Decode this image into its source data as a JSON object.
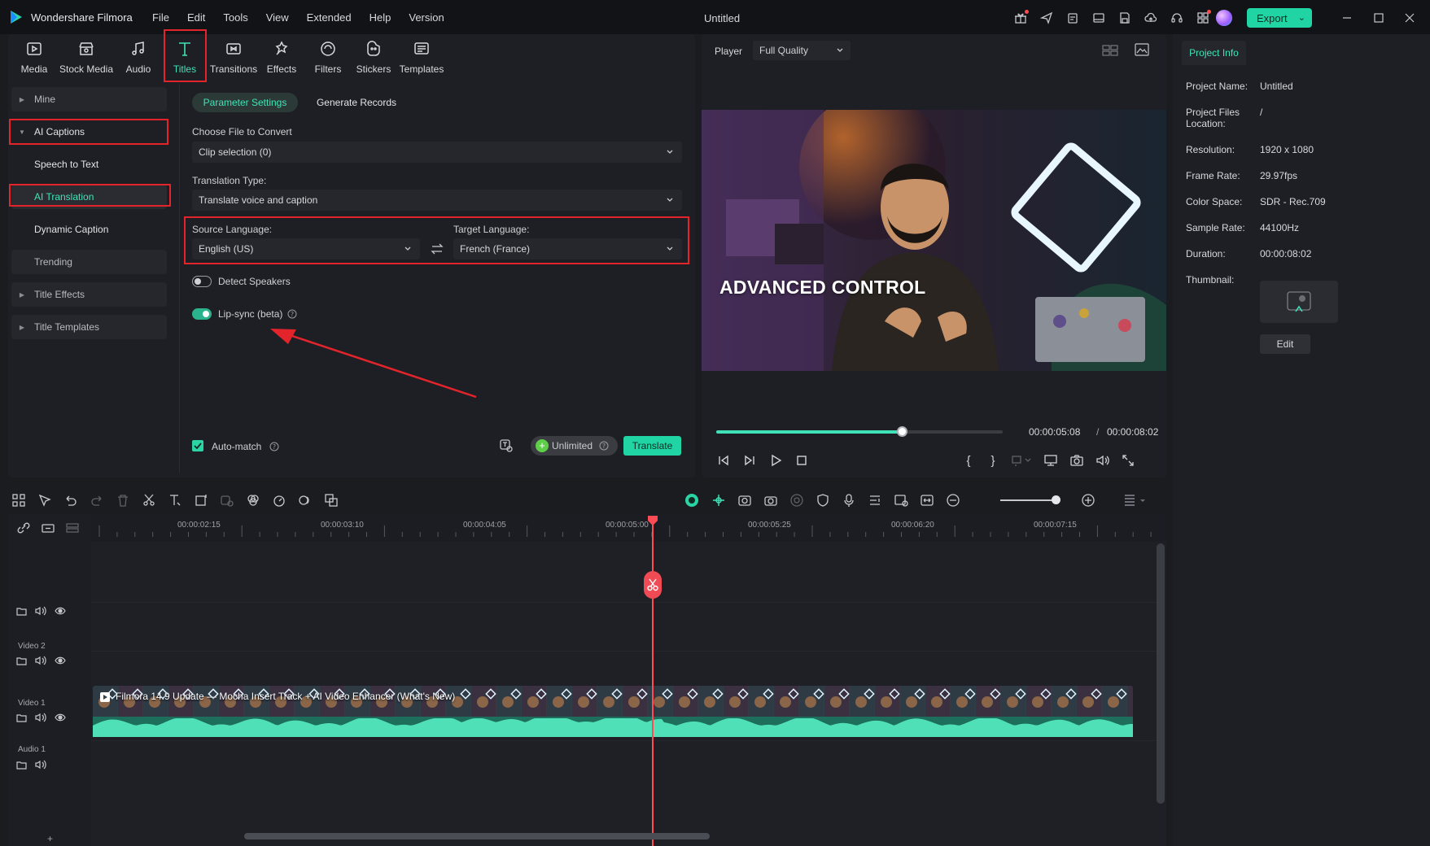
{
  "titlebar": {
    "app_name": "Wondershare Filmora",
    "menu": [
      "File",
      "Edit",
      "Tools",
      "View",
      "Extended",
      "Help",
      "Version"
    ],
    "window_title": "Untitled",
    "export_label": "Export"
  },
  "toolbar": {
    "items": [
      {
        "label": "Media",
        "icon": "media-icon"
      },
      {
        "label": "Stock Media",
        "icon": "stock-media-icon"
      },
      {
        "label": "Audio",
        "icon": "audio-icon"
      },
      {
        "label": "Titles",
        "icon": "titles-icon",
        "active": true
      },
      {
        "label": "Transitions",
        "icon": "transitions-icon"
      },
      {
        "label": "Effects",
        "icon": "effects-icon"
      },
      {
        "label": "Filters",
        "icon": "filters-icon"
      },
      {
        "label": "Stickers",
        "icon": "stickers-icon"
      },
      {
        "label": "Templates",
        "icon": "templates-icon"
      }
    ]
  },
  "sidebar": {
    "items": [
      {
        "label": "Mine"
      },
      {
        "label": "AI Captions"
      },
      {
        "label": "Speech to Text"
      },
      {
        "label": "AI Translation"
      },
      {
        "label": "Dynamic Caption"
      },
      {
        "label": "Trending"
      },
      {
        "label": "Title Effects"
      },
      {
        "label": "Title Templates"
      }
    ]
  },
  "settings": {
    "tab_parameter": "Parameter Settings",
    "tab_records": "Generate Records",
    "choose_file_label": "Choose File to Convert",
    "choose_file_value": "Clip selection (0)",
    "translation_type_label": "Translation Type:",
    "translation_type_value": "Translate voice and caption",
    "source_language_label": "Source Language:",
    "source_language_value": "English (US)",
    "target_language_label": "Target Language:",
    "target_language_value": "French (France)",
    "detect_speakers_label": "Detect Speakers",
    "detect_speakers_on": false,
    "lipsync_label": "Lip-sync (beta)",
    "lipsync_on": true,
    "automatch_label": "Auto-match",
    "automatch_checked": true,
    "unlimited_label": "Unlimited",
    "translate_label": "Translate"
  },
  "player": {
    "label": "Player",
    "quality": "Full Quality",
    "video_overlay_text": "ADVANCED CONTROL",
    "current_time": "00:00:05:08",
    "separator": "/",
    "total_time": "00:00:08:02",
    "progress": 0.65
  },
  "project_info": {
    "tab": "Project Info",
    "fields": [
      {
        "key": "Project Name:",
        "value": "Untitled"
      },
      {
        "key": "Project Files Location:",
        "value": "/"
      },
      {
        "key": "Resolution:",
        "value": "1920 x 1080"
      },
      {
        "key": "Frame Rate:",
        "value": "29.97fps"
      },
      {
        "key": "Color Space:",
        "value": "SDR - Rec.709"
      },
      {
        "key": "Sample Rate:",
        "value": "44100Hz"
      },
      {
        "key": "Duration:",
        "value": "00:00:08:02"
      },
      {
        "key": "Thumbnail:",
        "value": ""
      }
    ],
    "edit_label": "Edit"
  },
  "timeline": {
    "ticks": [
      "00:00:02:15",
      "00:00:03:10",
      "00:00:04:05",
      "00:00:05:00",
      "00:00:05:25",
      "00:00:06:20",
      "00:00:07:15"
    ],
    "tracks": {
      "video2": "Video 2",
      "video1": "Video 1",
      "audio1": "Audio 1"
    },
    "clip_title": "Filmora 14.9 Update — Mocha Insert Track + AI Video Enhancer (What's New)",
    "add_track": "+"
  },
  "colors": {
    "accent": "#21d4a4",
    "highlight": "#e3242b",
    "playhead": "#ff4b55"
  }
}
